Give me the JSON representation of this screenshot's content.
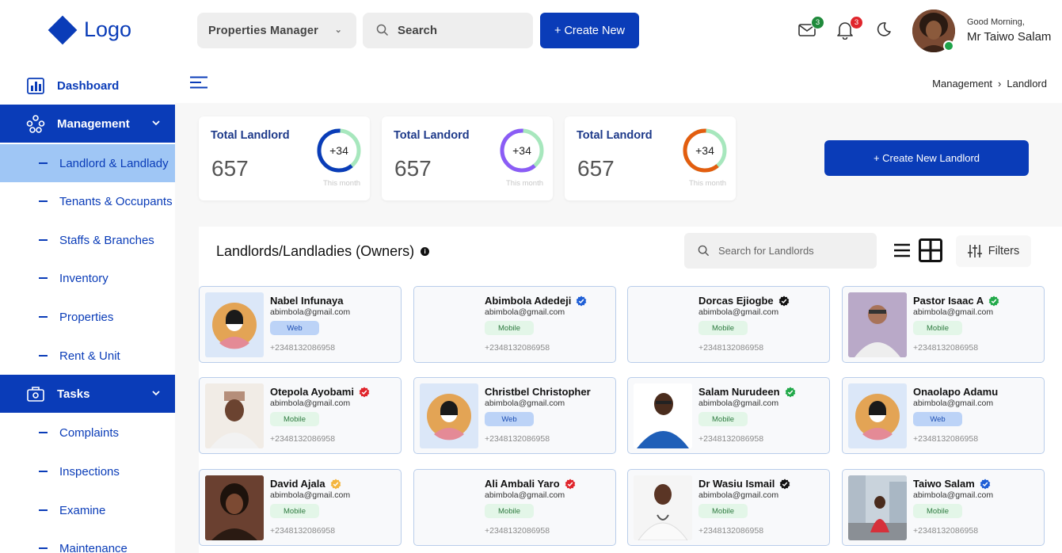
{
  "header": {
    "logo_text": "Logo",
    "workspace_select": "Properties Manager",
    "search_placeholder": "Search",
    "create_new_label": "+ Create New",
    "mail_count": "3",
    "notif_count": "3",
    "greeting": "Good Morning,",
    "user_name": "Mr Taiwo Salam"
  },
  "sidebar": {
    "dashboard": "Dashboard",
    "management": "Management",
    "management_items": [
      "Landlord & Landlady",
      "Tenants & Occupants",
      "Staffs & Branches",
      "Inventory",
      "Properties",
      "Rent & Unit"
    ],
    "tasks": "Tasks",
    "task_items": [
      "Complaints",
      "Inspections",
      "Examine",
      "Maintenance"
    ]
  },
  "breadcrumb": {
    "parent": "Management",
    "sep": "›",
    "current": "Landlord"
  },
  "stats": [
    {
      "title": "Total Landlord",
      "value": "657",
      "delta": "+34",
      "sub": "This month",
      "ring_color": "#0a3cb8",
      "ring_fill": 0.62
    },
    {
      "title": "Total Landord",
      "value": "657",
      "delta": "+34",
      "sub": "This month",
      "ring_color": "#8b5cf6",
      "ring_fill": 0.62
    },
    {
      "title": "Total Landord",
      "value": "657",
      "delta": "+34",
      "sub": "This month",
      "ring_color": "#e35d0f",
      "ring_fill": 0.62
    }
  ],
  "create_landlord_label": "+ Create New Landlord",
  "list": {
    "title": "Landlords/Landladies (Owners)",
    "info_icon": "i",
    "search_placeholder": "Search for Landlords",
    "filters_label": "Filters"
  },
  "landlords": [
    {
      "name": "Nabel Infunaya",
      "email": "abimbola@gmail.com",
      "tag": "Web",
      "phone": "+2348132086958",
      "verified": "",
      "photo": "default"
    },
    {
      "name": "Abimbola Adedeji",
      "email": "abimbola@gmail.com",
      "tag": "Mobile",
      "phone": "+2348132086958",
      "verified": "#1f5fd6",
      "photo": "none"
    },
    {
      "name": "Dorcas Ejiogbe",
      "email": "abimbola@gmail.com",
      "tag": "Mobile",
      "phone": "+2348132086958",
      "verified": "#111111",
      "photo": "none"
    },
    {
      "name": "Pastor Isaac A",
      "email": "abimbola@gmail.com",
      "tag": "Mobile",
      "phone": "+2348132086958",
      "verified": "#22a94a",
      "photo": "person-white"
    },
    {
      "name": "Otepola Ayobami",
      "email": "abimbola@gmail.com",
      "tag": "Mobile",
      "phone": "+2348132086958",
      "verified": "#e0252c",
      "photo": "person-cap"
    },
    {
      "name": "Christbel Christopher",
      "email": "abimbola@gmail.com",
      "tag": "Web",
      "phone": "+2348132086958",
      "verified": "",
      "photo": "default"
    },
    {
      "name": "Salam Nurudeen",
      "email": "abimbola@gmail.com",
      "tag": "Mobile",
      "phone": "+2348132086958",
      "verified": "#22a94a",
      "photo": "person-blue"
    },
    {
      "name": "Onaolapo Adamu",
      "email": "abimbola@gmail.com",
      "tag": "Web",
      "phone": "+2348132086958",
      "verified": "",
      "photo": "default"
    },
    {
      "name": "David Ajala",
      "email": "abimbola@gmail.com",
      "tag": "Mobile",
      "phone": "+2348132086958",
      "verified": "#f4b63f",
      "photo": "person-dark"
    },
    {
      "name": "Ali Ambali Yaro",
      "email": "abimbola@gmail.com",
      "tag": "Mobile",
      "phone": "+2348132086958",
      "verified": "#e0252c",
      "photo": "none"
    },
    {
      "name": "Dr Wasiu Ismail",
      "email": "abimbola@gmail.com",
      "tag": "Mobile",
      "phone": "+2348132086958",
      "verified": "#111111",
      "photo": "person-doctor"
    },
    {
      "name": "Taiwo Salam",
      "email": "abimbola@gmail.com",
      "tag": "Mobile",
      "phone": "+2348132086958",
      "verified": "#1f5fd6",
      "photo": "person-street"
    }
  ]
}
